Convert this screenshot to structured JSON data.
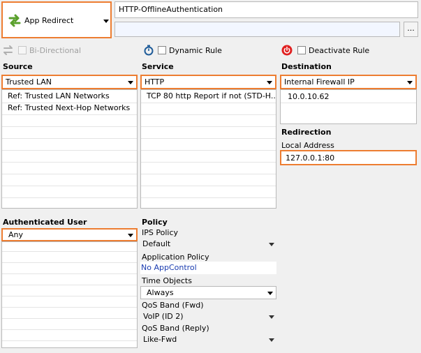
{
  "action": {
    "label": "App Redirect",
    "icon": "app-redirect-icon"
  },
  "rule_name": "HTTP-OfflineAuthentication",
  "description_value": "",
  "browse_button_label": "...",
  "options": {
    "bidirectional": "Bi-Directional",
    "dynamic_rule": "Dynamic Rule",
    "deactivate_rule": "Deactivate Rule"
  },
  "source": {
    "heading": "Source",
    "selected": "Trusted  LAN",
    "items": [
      "Ref: Trusted LAN Networks",
      "Ref: Trusted Next-Hop Networks"
    ]
  },
  "service": {
    "heading": "Service",
    "selected": "HTTP",
    "items": [
      "TCP  80 http  Report if not (STD-H..."
    ]
  },
  "destination": {
    "heading": "Destination",
    "selected": "Internal Firewall IP",
    "items": [
      "10.0.10.62"
    ]
  },
  "redirection": {
    "heading": "Redirection",
    "local_address_label": "Local Address",
    "local_address_value": "127.0.0.1:80"
  },
  "auth_user": {
    "heading": "Authenticated User",
    "selected": "Any"
  },
  "policy": {
    "heading": "Policy",
    "ips_label": "IPS Policy",
    "ips_value": "Default",
    "app_label": "Application Policy",
    "app_value": "No AppControl",
    "time_label": "Time Objects",
    "time_value": "Always",
    "qos_fwd_label": "QoS Band (Fwd)",
    "qos_fwd_value": "VoIP (ID 2)",
    "qos_reply_label": "QoS Band (Reply)",
    "qos_reply_value": "Like-Fwd"
  },
  "colors": {
    "accent": "#ed7d31",
    "link": "#1a3cb0",
    "icon_green": "#5aa02c",
    "icon_red": "#e02020"
  }
}
